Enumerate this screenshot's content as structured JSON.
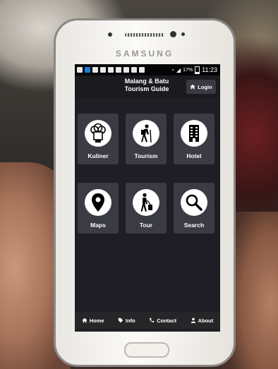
{
  "device": {
    "brand": "SAMSUNG"
  },
  "status_bar": {
    "battery": "17%",
    "time": "11:23"
  },
  "app": {
    "title_line1": "Malang & Batu",
    "title_line2": "Tourism Guide",
    "login_label": "Login"
  },
  "menu": [
    {
      "label": "Kuliner",
      "icon": "chef-hat-icon"
    },
    {
      "label": "Tourism",
      "icon": "hiker-icon"
    },
    {
      "label": "Hotel",
      "icon": "hotel-building-icon"
    },
    {
      "label": "Maps",
      "icon": "map-pin-icon"
    },
    {
      "label": "Tour",
      "icon": "traveler-luggage-icon"
    },
    {
      "label": "Search",
      "icon": "magnifier-icon"
    }
  ],
  "footer": {
    "home": "Home",
    "info": "Info",
    "contact": "Contact",
    "about": "About"
  },
  "colors": {
    "screen_bg": "#1e1e24",
    "tile_bg": "#3b3b44",
    "footer_bg": "#262629"
  }
}
